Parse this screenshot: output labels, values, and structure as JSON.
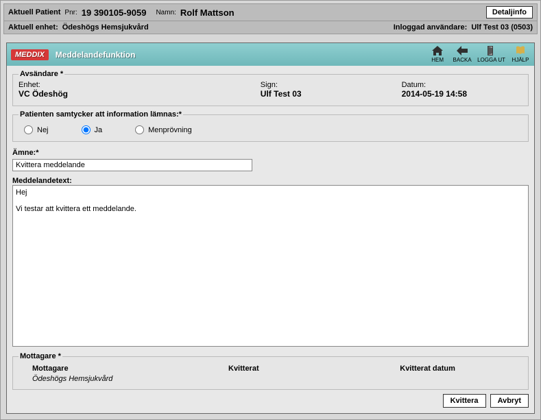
{
  "top": {
    "aktuell_patient_label": "Aktuell Patient",
    "pnr_label": "Pnr:",
    "pnr_value": "19 390105-9059",
    "namn_label": "Namn:",
    "namn_value": "Rolf Mattson",
    "detail_button": "Detaljinfo",
    "aktuell_enhet_label": "Aktuell enhet:",
    "aktuell_enhet_value": "Ödeshögs Hemsjukvård",
    "loggedin_label": "Inloggad användare:",
    "loggedin_value": "Ulf Test 03 (0503)"
  },
  "brand": "MEDDIX",
  "panel_title": "Meddelandefunktion",
  "toolbar": {
    "hem": "HEM",
    "backa": "BACKA",
    "loggaut": "LOGGA UT",
    "hjalp": "HJÄLP"
  },
  "sender": {
    "section_label": "Avsändare *",
    "enhet_label": "Enhet:",
    "enhet_value": "VC Ödeshög",
    "sign_label": "Sign:",
    "sign_value": "Ulf Test 03",
    "datum_label": "Datum:",
    "datum_value": "2014-05-19 14:58"
  },
  "consent": {
    "section_label": "Patienten samtycker att information lämnas:*",
    "options": {
      "nej": "Nej",
      "ja": "Ja",
      "men": "Menprövning"
    },
    "selected": "ja"
  },
  "subject": {
    "label": "Ämne:*",
    "value": "Kvittera meddelande"
  },
  "message": {
    "label": "Meddelandetext:",
    "value": "Hej\n\nVi testar att kvittera ett meddelande."
  },
  "recipients": {
    "section_label": "Mottagare *",
    "headers": {
      "mottagare": "Mottagare",
      "kvitterat": "Kvitterat",
      "kvitterat_datum": "Kvitterat datum"
    },
    "rows": [
      {
        "mottagare": "Ödeshögs Hemsjukvård",
        "kvitterat": "",
        "kvitterat_datum": ""
      }
    ]
  },
  "actions": {
    "kvittera": "Kvittera",
    "avbryt": "Avbryt"
  }
}
